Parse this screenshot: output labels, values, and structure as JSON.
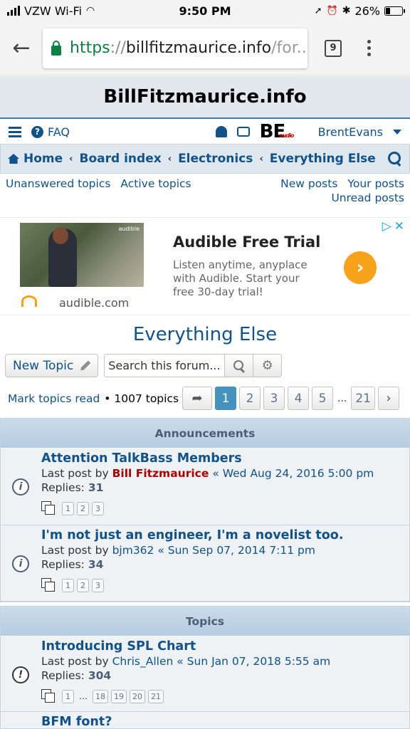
{
  "status": {
    "carrier": "VZW Wi-Fi",
    "time": "9:50 PM",
    "battery": "26%"
  },
  "browser": {
    "url_scheme": "https",
    "url_sep": "://",
    "url_host": "billfitzmaurice.info",
    "url_rest": "/for...",
    "tab_count": "9"
  },
  "site": {
    "title": "BillFitzmaurice.info"
  },
  "nav": {
    "faq": "FAQ",
    "username": "BrentEvans",
    "logo_text": "BE",
    "logo_sub": "audio"
  },
  "breadcrumbs": {
    "home": "Home",
    "board_index": "Board index",
    "electronics": "Electronics",
    "everything_else": "Everything Else"
  },
  "quicklinks": {
    "unanswered": "Unanswered topics",
    "active": "Active topics",
    "new_posts": "New posts",
    "your_posts": "Your posts",
    "unread": "Unread posts"
  },
  "ad": {
    "title": "Audible Free Trial",
    "text": "Listen anytime, anyplace with Audible. Start your free 30-day trial!",
    "source": "audible.com",
    "brand": "audible"
  },
  "forum": {
    "title": "Everything Else",
    "new_topic": "New Topic",
    "search_placeholder": "Search this forum...",
    "mark_read": "Mark topics read",
    "topic_count": "• 1007 topics"
  },
  "pagination": {
    "pages": [
      "1",
      "2",
      "3",
      "4",
      "5"
    ],
    "ellipsis": "...",
    "last": "21",
    "current": "1"
  },
  "announcements": {
    "heading": "Announcements",
    "topics": [
      {
        "title": "Attention TalkBass Members",
        "last_post_label": "Last post by",
        "author": "Bill Fitzmaurice",
        "date": "« Wed Aug 24, 2016 5:00 pm",
        "replies_label": "Replies:",
        "replies": "31",
        "pages": [
          "1",
          "2",
          "3"
        ]
      },
      {
        "title": "I'm not just an engineer, I'm a novelist too.",
        "last_post_label": "Last post by",
        "author": "bjm362",
        "date": "« Sun Sep 07, 2014 7:11 pm",
        "replies_label": "Replies:",
        "replies": "34",
        "pages": [
          "1",
          "2",
          "3"
        ]
      }
    ]
  },
  "topics": {
    "heading": "Topics",
    "items": [
      {
        "title": "Introducing SPL Chart",
        "last_post_label": "Last post by",
        "author": "Chris_Allen",
        "date": "« Sun Jan 07, 2018 5:55 am",
        "replies_label": "Replies:",
        "replies": "304",
        "pages": [
          "1",
          "18",
          "19",
          "20",
          "21"
        ]
      },
      {
        "title": "BFM font?"
      }
    ]
  }
}
